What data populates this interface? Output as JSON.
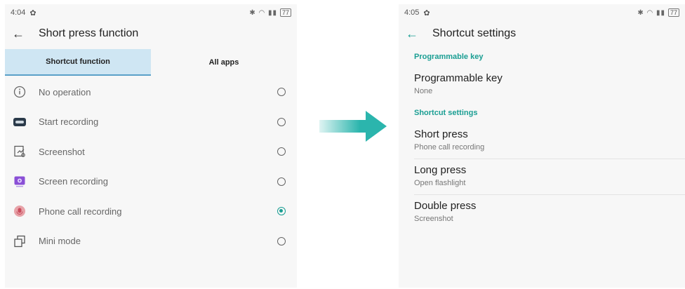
{
  "left": {
    "status": {
      "time": "4:04",
      "battery": "77"
    },
    "title": "Short press function",
    "tabs": [
      {
        "label": "Shortcut function",
        "active": true
      },
      {
        "label": "All apps",
        "active": false
      }
    ],
    "options": [
      {
        "label": "No operation",
        "icon": "info-icon",
        "selected": false
      },
      {
        "label": "Start recording",
        "icon": "recorder-icon",
        "selected": false
      },
      {
        "label": "Screenshot",
        "icon": "screenshot-icon",
        "selected": false
      },
      {
        "label": "Screen recording",
        "icon": "screen-recording-icon",
        "selected": false
      },
      {
        "label": "Phone call recording",
        "icon": "call-recording-icon",
        "selected": true
      },
      {
        "label": "Mini mode",
        "icon": "mini-mode-icon",
        "selected": false
      }
    ]
  },
  "right": {
    "status": {
      "time": "4:05",
      "battery": "77"
    },
    "title": "Shortcut settings",
    "section1": {
      "header": "Programmable key",
      "item": {
        "primary": "Programmable key",
        "secondary": "None"
      }
    },
    "section2": {
      "header": "Shortcut settings",
      "items": [
        {
          "primary": "Short press",
          "secondary": "Phone call recording"
        },
        {
          "primary": "Long press",
          "secondary": "Open flashlight"
        },
        {
          "primary": "Double press",
          "secondary": "Screenshot"
        }
      ]
    }
  },
  "colors": {
    "accent": "#1a9e93",
    "tab_active_bg": "#cfe6f3",
    "arrow": "#2bb5ad"
  }
}
